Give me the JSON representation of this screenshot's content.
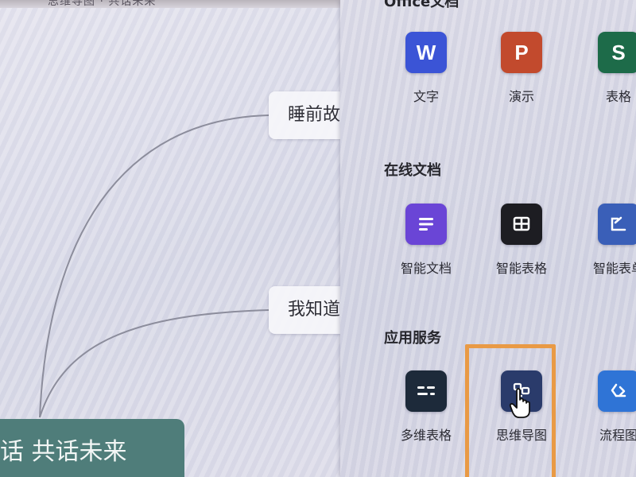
{
  "canvas": {
    "top_strip_text": "思维导图 · 共话未来",
    "nodes": [
      {
        "label": "睡前故事"
      },
      {
        "label": "我知道了"
      }
    ],
    "root": {
      "label": "话 共话未来"
    }
  },
  "panel": {
    "sections": [
      {
        "title": "Office文档",
        "items": [
          {
            "label": "文字",
            "glyph": "W",
            "color": "#3b54d6",
            "icon": "word-doc-icon"
          },
          {
            "label": "演示",
            "glyph": "P",
            "color": "#c24a2d",
            "icon": "presentation-icon"
          },
          {
            "label": "表格",
            "glyph": "S",
            "color": "#1d6b49",
            "icon": "spreadsheet-icon"
          }
        ]
      },
      {
        "title": "在线文档",
        "items": [
          {
            "label": "智能文档",
            "color": "#6a45d6",
            "icon": "smart-doc-icon"
          },
          {
            "label": "智能表格",
            "color": "#1d1d22",
            "icon": "smart-sheet-icon"
          },
          {
            "label": "智能表单",
            "color": "#3a5fb8",
            "icon": "smart-form-icon"
          }
        ]
      },
      {
        "title": "应用服务",
        "items": [
          {
            "label": "多维表格",
            "color": "#1d2a3a",
            "icon": "multi-dim-table-icon"
          },
          {
            "label": "思维导图",
            "color": "#2a3b6b",
            "icon": "mind-map-icon"
          },
          {
            "label": "流程图",
            "color": "#2f74d6",
            "icon": "flowchart-icon"
          }
        ]
      }
    ]
  },
  "highlight_color": "#e99a45"
}
